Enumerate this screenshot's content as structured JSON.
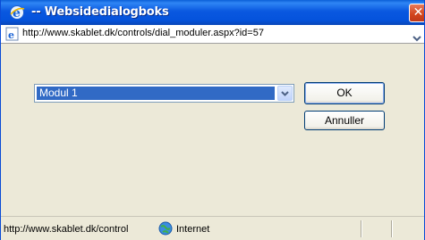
{
  "window": {
    "title": "-- Websidedialogboks",
    "close_glyph": "✕"
  },
  "address": {
    "url": "http://www.skablet.dk/controls/dial_moduler.aspx?id=57"
  },
  "form": {
    "module_select": {
      "value": "Modul 1"
    },
    "ok_label": "OK",
    "cancel_label": "Annuller"
  },
  "status": {
    "url_text": "http://www.skablet.dk/control",
    "zone_label": "Internet"
  },
  "colors": {
    "titlebar": "#0553dc",
    "selection": "#316ac5",
    "dialog_bg": "#ece9d8",
    "close": "#d2441c"
  },
  "icons": {
    "title": "ie-icon",
    "address": "ie-page-icon",
    "zone": "globe-icon",
    "dropdown": "chevron-down-icon"
  }
}
